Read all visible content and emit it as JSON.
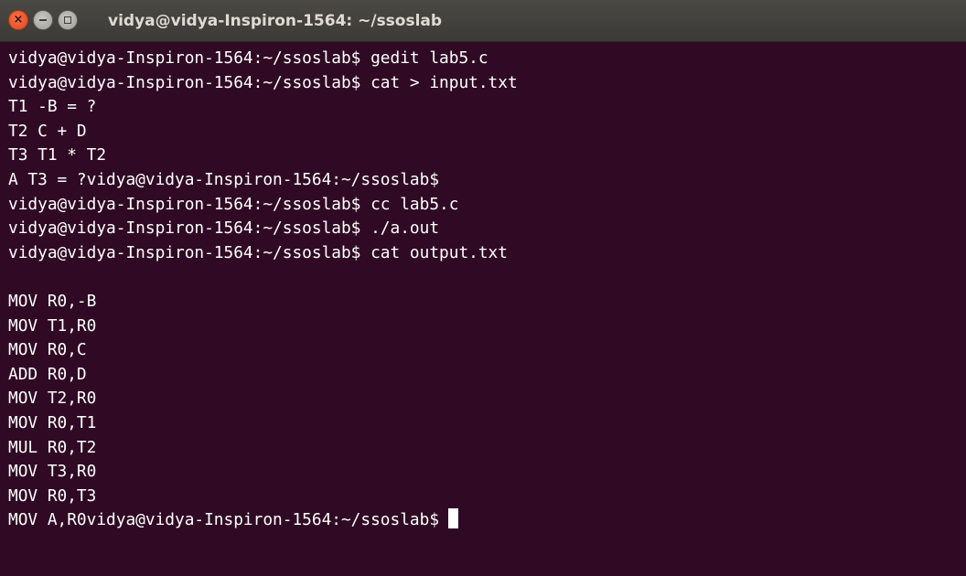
{
  "window": {
    "title": "vidya@vidya-Inspiron-1564: ~/ssoslab"
  },
  "terminal": {
    "lines": [
      "vidya@vidya-Inspiron-1564:~/ssoslab$ gedit lab5.c",
      "vidya@vidya-Inspiron-1564:~/ssoslab$ cat > input.txt",
      "T1 -B = ?",
      "T2 C + D",
      "T3 T1 * T2",
      "A T3 = ?vidya@vidya-Inspiron-1564:~/ssoslab$",
      "vidya@vidya-Inspiron-1564:~/ssoslab$ cc lab5.c",
      "vidya@vidya-Inspiron-1564:~/ssoslab$ ./a.out",
      "vidya@vidya-Inspiron-1564:~/ssoslab$ cat output.txt",
      "",
      "MOV R0,-B",
      "MOV T1,R0",
      "MOV R0,C",
      "ADD R0,D",
      "MOV T2,R0",
      "MOV R0,T1",
      "MUL R0,T2",
      "MOV T3,R0",
      "MOV R0,T3",
      "MOV A,R0vidya@vidya-Inspiron-1564:~/ssoslab$"
    ]
  },
  "colors": {
    "background": "#300a24",
    "text": "#ffffff",
    "titlebar": "#3c3b37",
    "close_button": "#e95420"
  }
}
